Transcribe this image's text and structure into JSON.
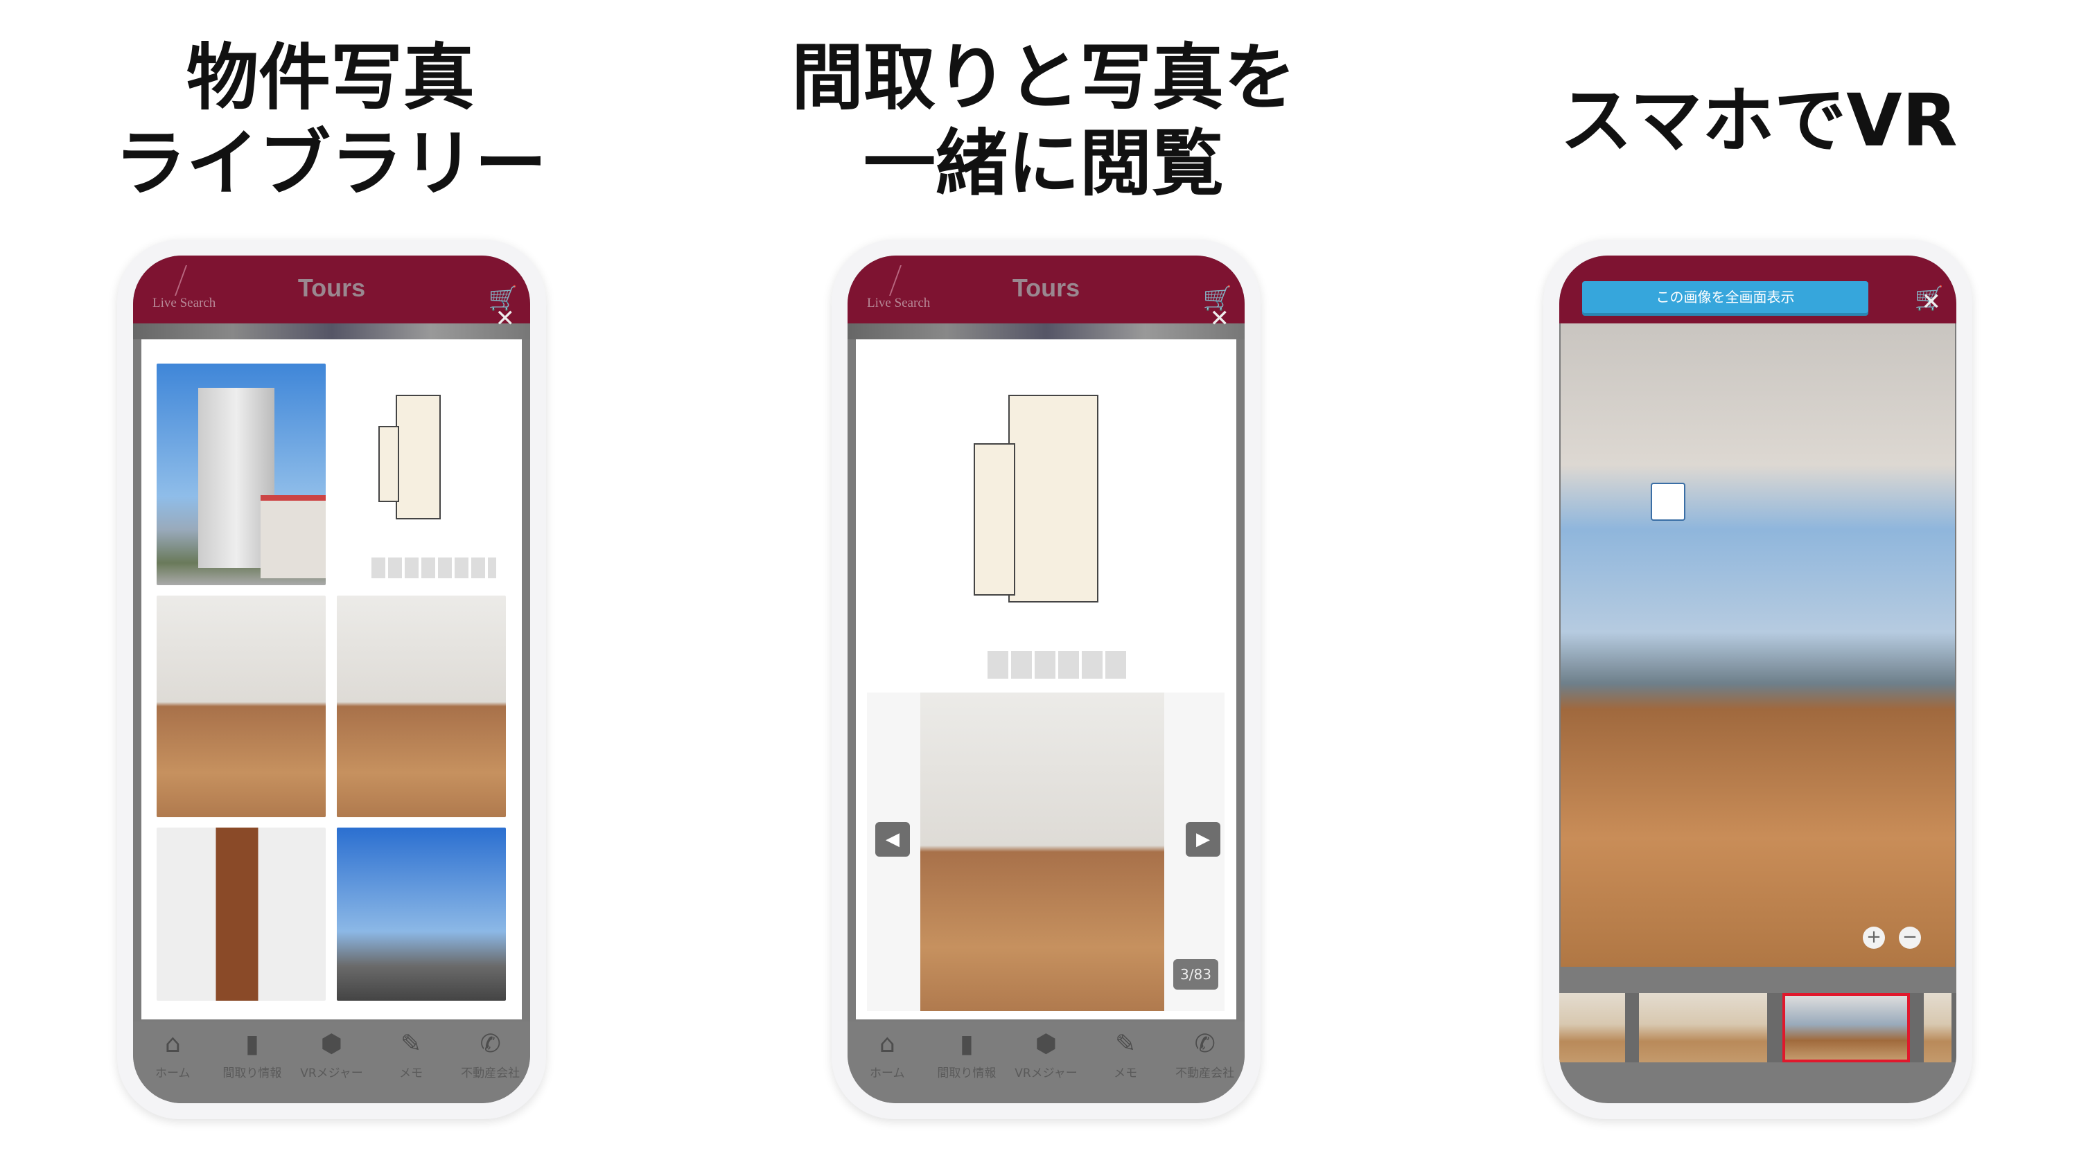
{
  "headings": {
    "left": [
      "物件写真",
      "ライブラリー"
    ],
    "middle": [
      "間取りと写真を",
      "一緒に閲覧"
    ],
    "right": "スマホでVR"
  },
  "app": {
    "brand": "Live Search",
    "title": "Tours",
    "icons": {
      "cart": "cart-icon",
      "close": "close-icon"
    },
    "accent_color": "#7e1331",
    "nav": [
      {
        "label": "ホーム",
        "icon": "home-icon",
        "glyph": "⌂"
      },
      {
        "label": "間取り情報",
        "icon": "door-icon",
        "glyph": "▮"
      },
      {
        "label": "VRメジャー",
        "icon": "cubes-icon",
        "glyph": "⬢"
      },
      {
        "label": "メモ",
        "icon": "memo-edit-icon",
        "glyph": "✎"
      },
      {
        "label": "不動産会社",
        "icon": "phone-icon",
        "glyph": "✆"
      }
    ]
  },
  "viewer": {
    "counter": "3/83",
    "prev_icon": "chevron-left-icon",
    "next_icon": "chevron-right-icon"
  },
  "vr": {
    "fullscreen_button": "この画像を全画面表示",
    "zoom_in": "+",
    "zoom_out": "−",
    "button_color": "#36a6dc"
  }
}
